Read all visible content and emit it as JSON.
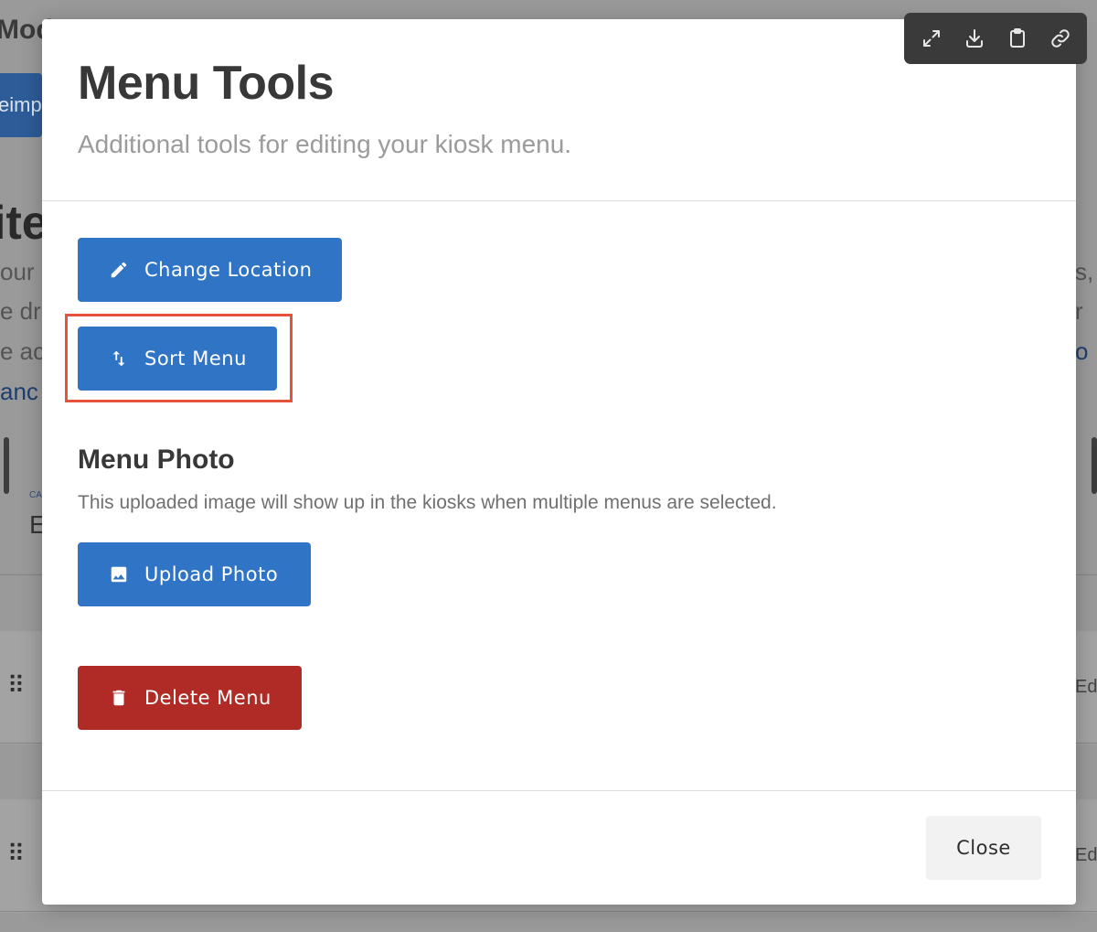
{
  "background": {
    "title_fragment": "Mod",
    "tab_fragment": "eimp",
    "heading_fragment": "ite",
    "lines": [
      "our",
      "e dr",
      "e ac",
      "anc"
    ],
    "right_lines": [
      "s,",
      "r",
      "o"
    ],
    "small_label": "CA",
    "letter": "E",
    "edit_fragment": "Ed"
  },
  "modal": {
    "title": "Menu Tools",
    "subtitle": "Additional tools for editing your kiosk menu.",
    "buttons": {
      "change_location": "Change Location",
      "sort_menu": "Sort Menu",
      "upload_photo": "Upload Photo",
      "delete_menu": "Delete Menu"
    },
    "photo_section": {
      "title": "Menu Photo",
      "description": "This uploaded image will show up in the kiosks when multiple menus are selected."
    },
    "close_label": "Close"
  },
  "toolbar": {
    "icons": [
      "expand-icon",
      "download-icon",
      "clipboard-icon",
      "link-icon"
    ]
  },
  "colors": {
    "primary": "#3075c5",
    "danger": "#b12b26",
    "highlight": "#e5533d",
    "toolbar": "#3a3a3a"
  }
}
